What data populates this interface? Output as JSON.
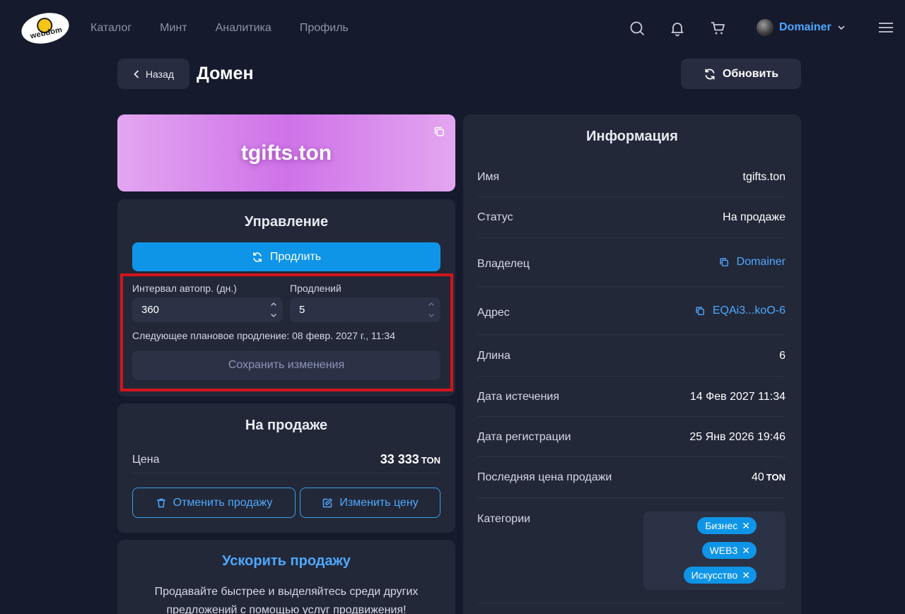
{
  "header": {
    "logo_text": "webdom",
    "nav": [
      "Каталог",
      "Минт",
      "Аналитика",
      "Профиль"
    ],
    "user_name": "Domainer"
  },
  "title_row": {
    "back_label": "Назад",
    "page_title": "Домен",
    "refresh_label": "Обновить"
  },
  "banner": {
    "domain": "tgifts.ton"
  },
  "management": {
    "title": "Управление",
    "renew_label": "Продлить",
    "interval_label": "Интервал автопр. (дн.)",
    "interval_value": "360",
    "renewals_label": "Продлений",
    "renewals_value": "5",
    "schedule_text": "Следующее плановое продление: 08 февр. 2027 г., 11:34",
    "save_label": "Сохранить изменения"
  },
  "sale": {
    "title": "На продаже",
    "price_label": "Цена",
    "price_value": "33 333",
    "price_unit": "TON",
    "cancel_label": "Отменить продажу",
    "edit_label": "Изменить цену"
  },
  "boost": {
    "title": "Ускорить продажу",
    "text": "Продавайте быстрее и выделяйтесь среди других предложений с помощью услуг продвижения!"
  },
  "info": {
    "title": "Информация",
    "rows": [
      {
        "label": "Имя",
        "value": "tgifts.ton"
      },
      {
        "label": "Статус",
        "value": "На продаже"
      },
      {
        "label": "Владелец",
        "value": "Domainer"
      },
      {
        "label": "Адрес",
        "value": "EQAi3...koO-6"
      },
      {
        "label": "Длина",
        "value": "6"
      },
      {
        "label": "Дата истечения",
        "value": "14 Фев 2027 11:34"
      },
      {
        "label": "Дата регистрации",
        "value": "25 Янв 2026 19:46"
      },
      {
        "label": "Последняя цена продажи",
        "value": "40",
        "unit": "TON"
      },
      {
        "label": "Категории"
      }
    ],
    "categories": [
      "Бизнес",
      "WEB3",
      "Искусство"
    ]
  },
  "colors": {
    "background": "#161a2d",
    "card": "#232839",
    "accent": "#0e95e8",
    "link": "#4ea8ff",
    "highlight": "#d4141c"
  }
}
